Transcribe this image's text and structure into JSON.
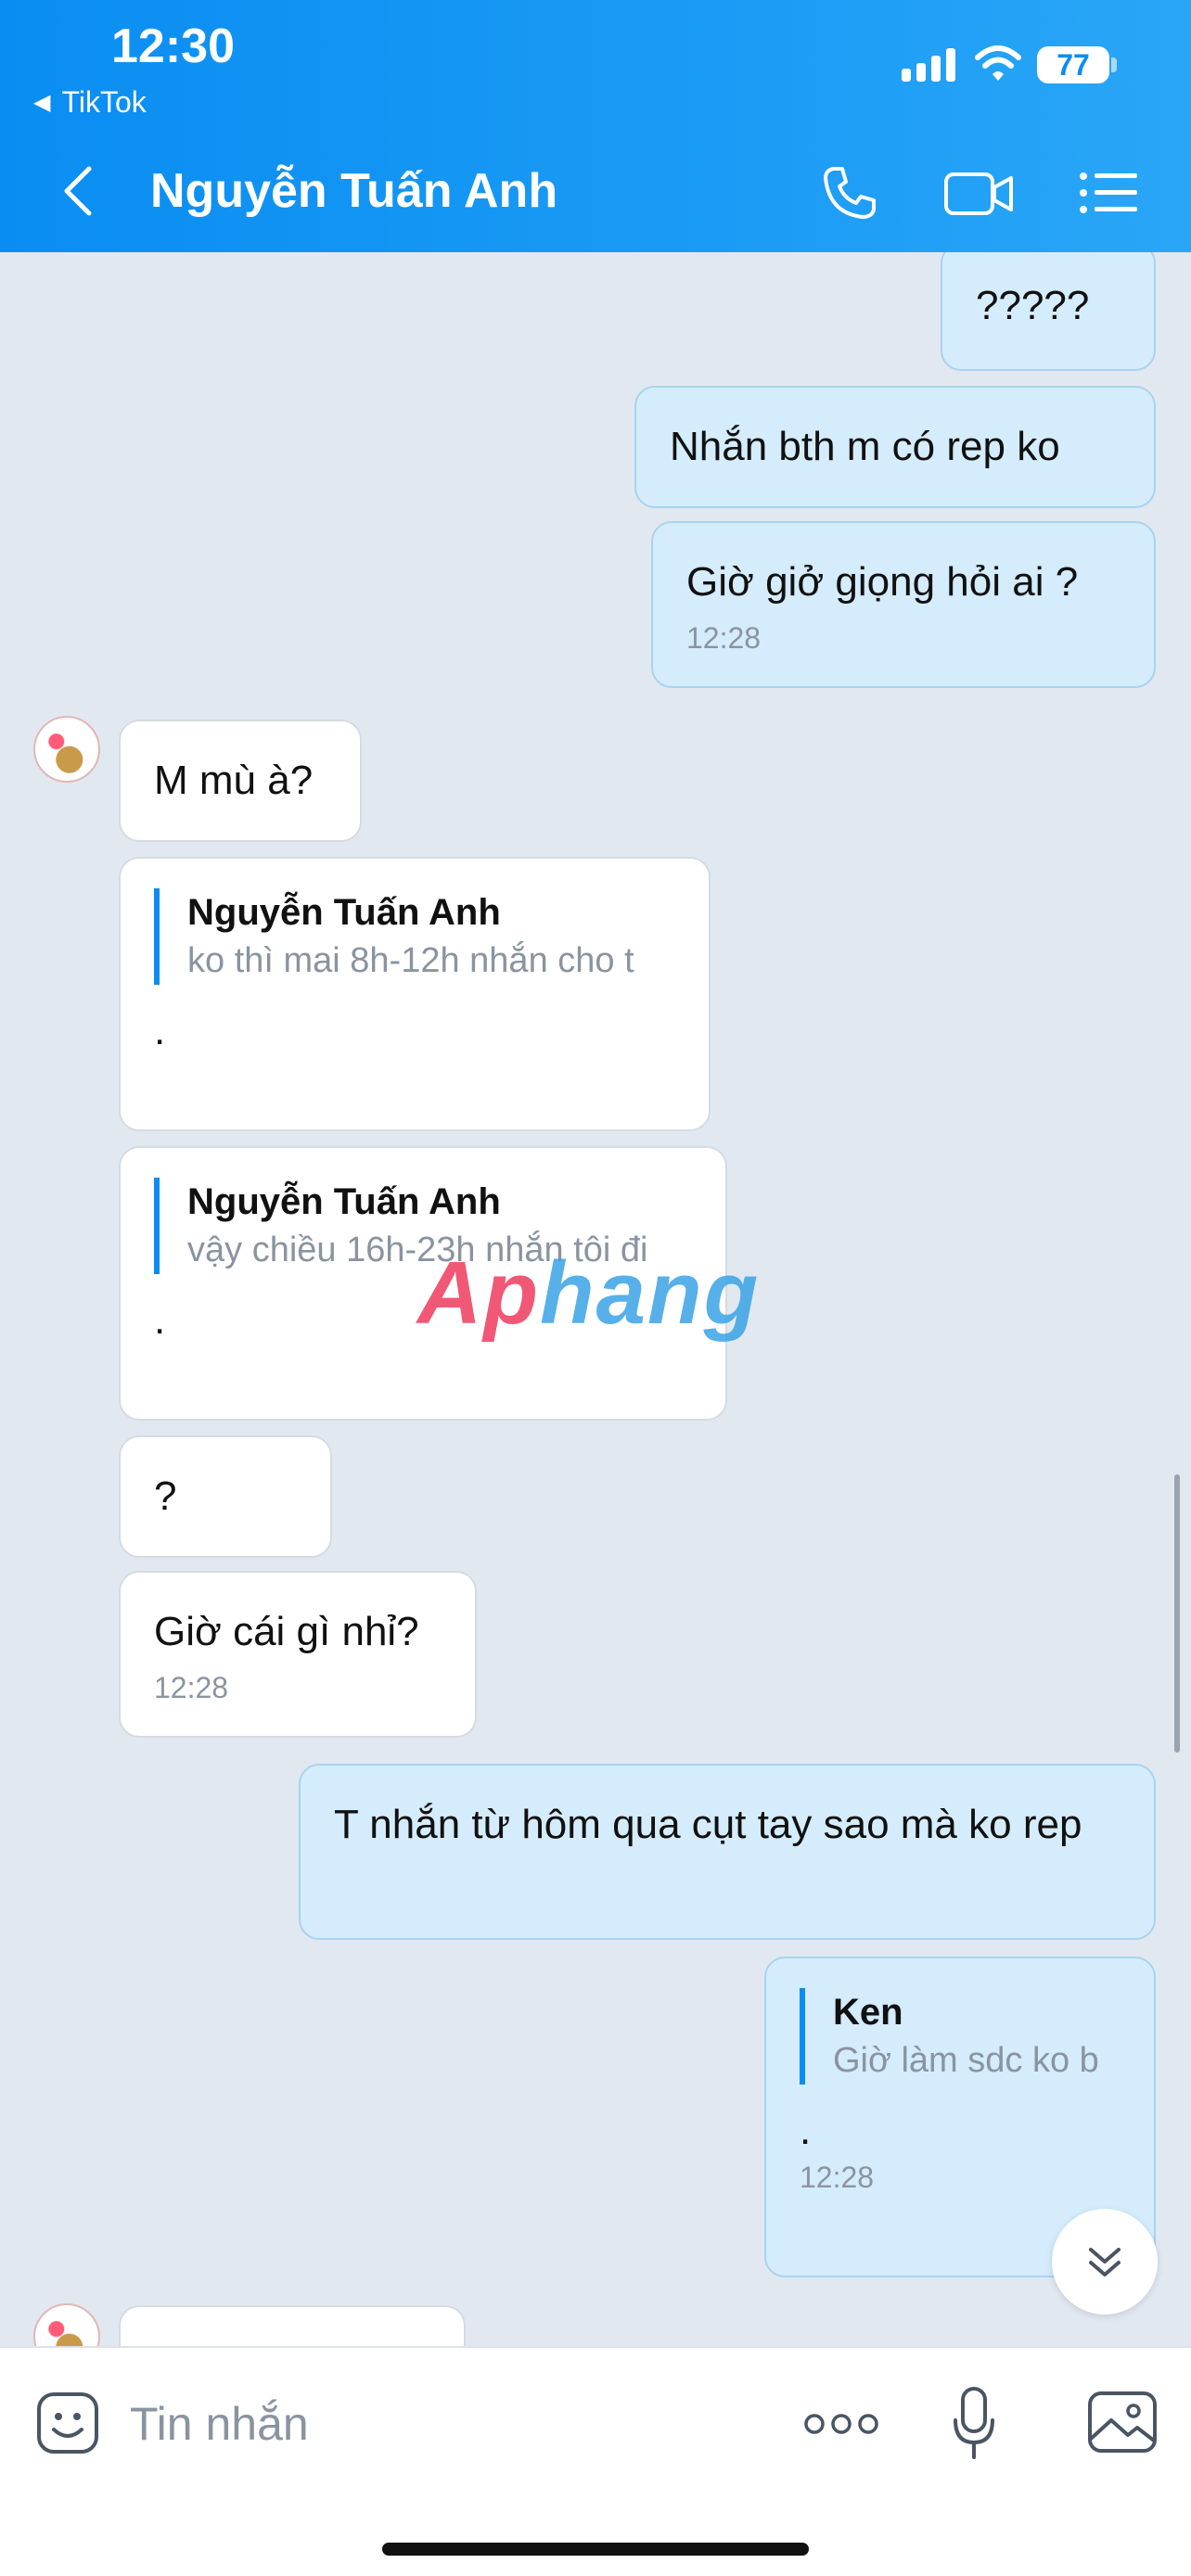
{
  "status": {
    "time": "12:30",
    "back_app": "TikTok",
    "battery": "77"
  },
  "header": {
    "title": "Nguyễn Tuấn Anh"
  },
  "messages": [
    {
      "text": "?????"
    },
    {
      "text": "Nhắn bth m có rep ko"
    },
    {
      "text": "Giờ giở giọng hỏi ai ?",
      "time": "12:28"
    },
    {
      "text": "M mù à?"
    },
    {
      "quote_name": "Nguyễn Tuấn Anh",
      "quote_text": "ko thì mai 8h-12h nhắn cho t",
      "text": "."
    },
    {
      "quote_name": "Nguyễn Tuấn Anh",
      "quote_text": "vậy chiều 16h-23h nhắn tôi đi",
      "text": "."
    },
    {
      "text": "?"
    },
    {
      "text": "Giờ cái gì nhỉ?",
      "time": "12:28"
    },
    {
      "text": "T nhắn từ hôm qua cụt tay sao mà ko rep"
    },
    {
      "quote_name": "Ken",
      "quote_text": "Giờ làm sdc ko b",
      "text": ".",
      "time": "12:28"
    }
  ],
  "watermark": {
    "part1": "Ap",
    "part2": "hang"
  },
  "input": {
    "placeholder": "Tin nhắn"
  },
  "colors": {
    "header": "#0a8df2",
    "outgoing_bubble": "#d4ecfb",
    "incoming_bubble": "#ffffff"
  }
}
